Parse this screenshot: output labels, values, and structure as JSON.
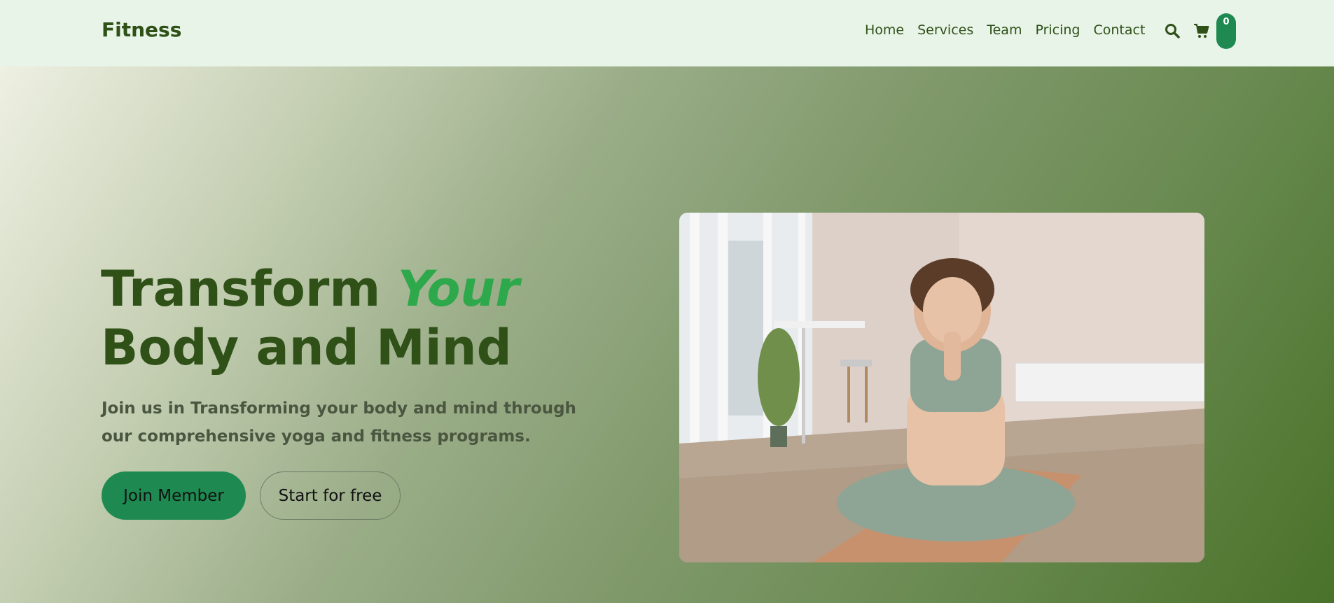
{
  "header": {
    "brand": "Fitness",
    "nav": [
      "Home",
      "Services",
      "Team",
      "Pricing",
      "Contact"
    ],
    "search_icon": "search-icon",
    "cart_icon": "shopping-cart-icon",
    "cart_count": "0"
  },
  "hero": {
    "title_line1": "Transform",
    "title_accent": "Your",
    "title_line2": "Body and Mind",
    "subtitle": "Join us in Transforming your body and mind through our comprehensive yoga and fitness programs.",
    "primary_button": "Join Member",
    "secondary_button": "Start for free",
    "image": "woman meditating cross-legged on yoga mat in bright room"
  },
  "colors": {
    "brand_dark_green": "#2f5118",
    "accent_green": "#2da84a",
    "button_green": "#1e8a52",
    "header_bg": "#e8f4e8"
  }
}
